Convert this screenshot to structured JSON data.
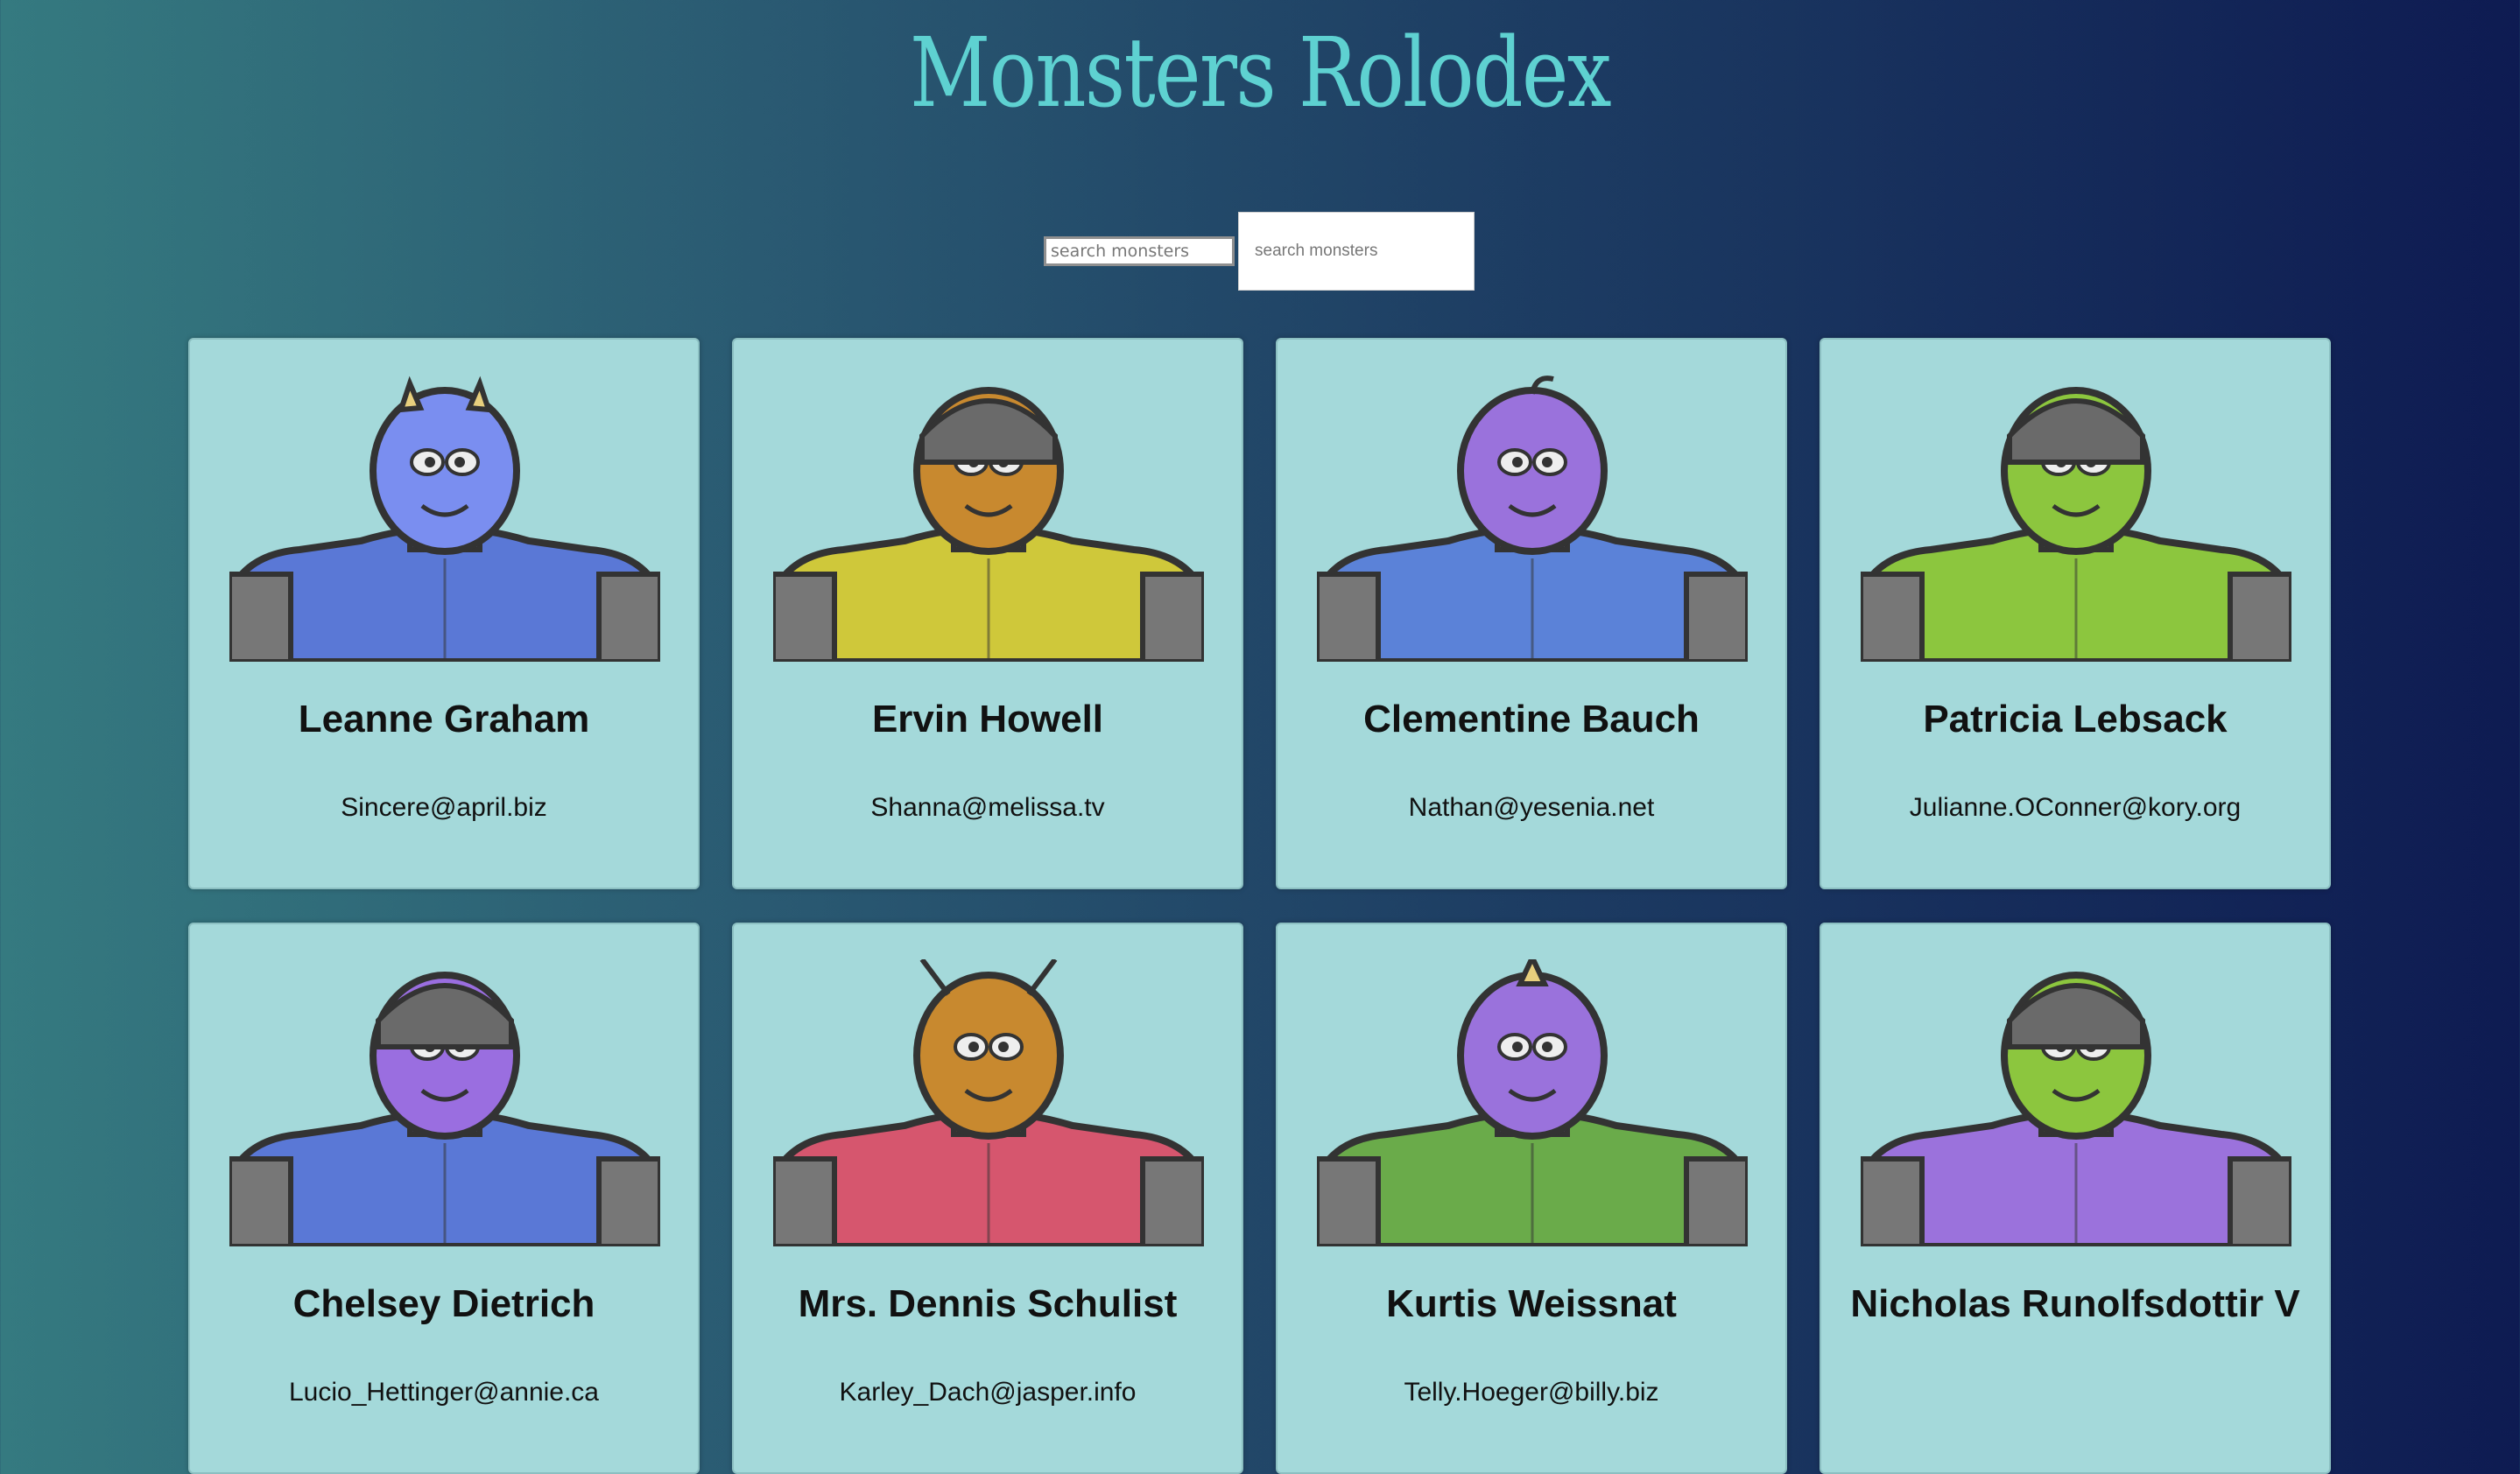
{
  "app": {
    "title": "Monsters Rolodex"
  },
  "search": {
    "placeholder": "search monsters",
    "value": ""
  },
  "monsters": [
    {
      "name": "Leanne Graham",
      "email": "Sincere@april.biz",
      "skin": "#7a8ef0",
      "suit": "#5a78d6",
      "hair": "blue-horns"
    },
    {
      "name": "Ervin Howell",
      "email": "Shanna@melissa.tv",
      "skin": "#c8892f",
      "suit": "#cfc83a",
      "hair": "orange-helmet"
    },
    {
      "name": "Clementine Bauch",
      "email": "Nathan@yesenia.net",
      "skin": "#9a72dc",
      "suit": "#5b82d8",
      "hair": "purple-antenna"
    },
    {
      "name": "Patricia Lebsack",
      "email": "Julianne.OConner@kory.org",
      "skin": "#8cc63e",
      "suit": "#8cc63e",
      "hair": "green-helmet"
    },
    {
      "name": "Chelsey Dietrich",
      "email": "Lucio_Hettinger@annie.ca",
      "skin": "#9a6ee0",
      "suit": "#5a78d6",
      "hair": "purple-helmet"
    },
    {
      "name": "Mrs. Dennis Schulist",
      "email": "Karley_Dach@jasper.info",
      "skin": "#c8892f",
      "suit": "#d6566e",
      "hair": "orange-antennae"
    },
    {
      "name": "Kurtis Weissnat",
      "email": "Telly.Hoeger@billy.biz",
      "skin": "#9a72dc",
      "suit": "#6aab4a",
      "hair": "purple-horn"
    },
    {
      "name": "Nicholas Runolfsdottir V",
      "email": "",
      "skin": "#8cc63e",
      "suit": "#9b72dc",
      "hair": "green-helmet"
    }
  ]
}
